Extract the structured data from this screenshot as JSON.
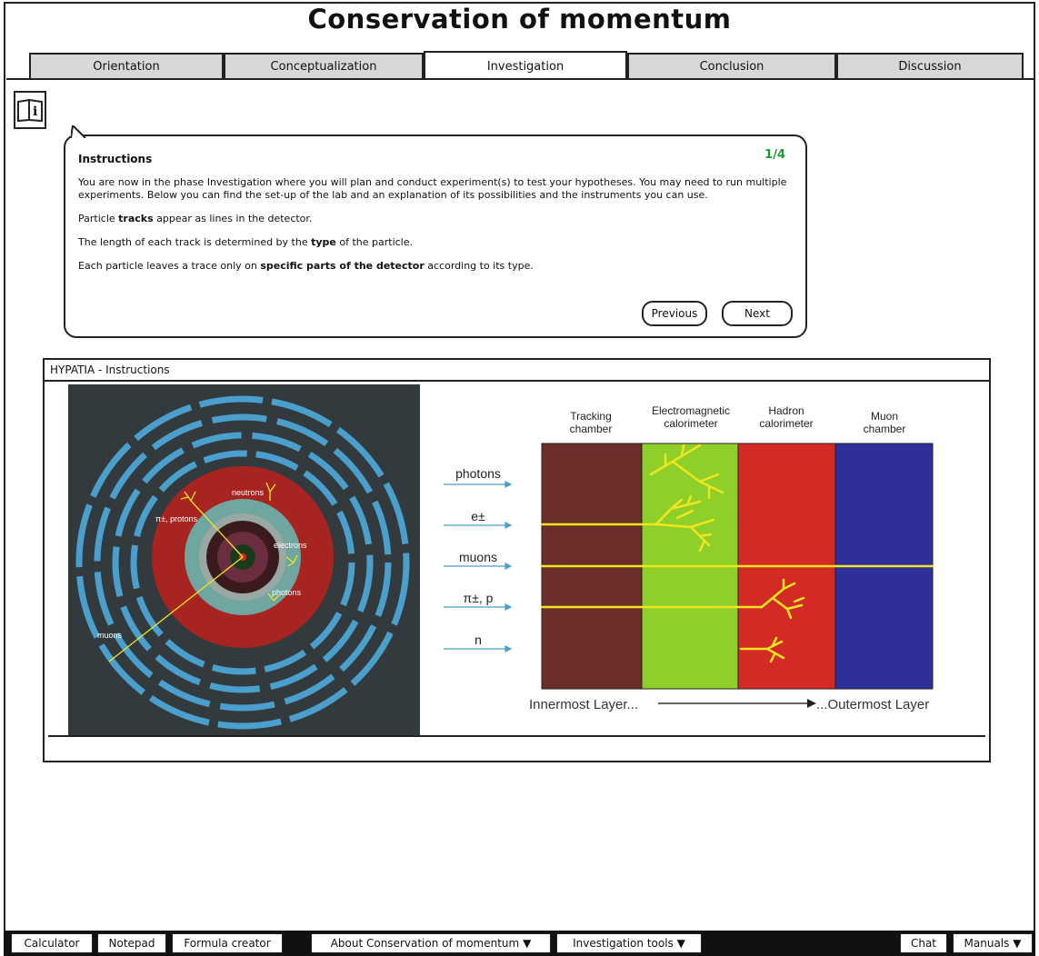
{
  "app": {
    "title": "Conservation of momentum"
  },
  "tabs": [
    {
      "label": "Orientation"
    },
    {
      "label": "Conceptualization"
    },
    {
      "label": "Investigation",
      "active": true
    },
    {
      "label": "Conclusion"
    },
    {
      "label": "Discussion"
    }
  ],
  "instructions": {
    "title": "Instructions",
    "page": "1/4",
    "paragraph1": "You are now in the phase Investigation where you will plan and conduct experiment(s) to test your hypotheses. You may need to run multiple experiments. Below you can find the set-up of the lab and an explanation of its possibilities and the instruments you can use.",
    "p2_pre": "Particle ",
    "p2_bold": "tracks",
    "p2_post": " appear as lines in the detector.",
    "p3_pre": "The length of each track is determined by the ",
    "p3_bold": "type",
    "p3_post": " of the particle.",
    "p4_pre": "Each particle leaves a trace only on ",
    "p4_bold": "specific parts of the detector",
    "p4_post": " according to its type.",
    "previous_label": "Previous",
    "next_label": "Next"
  },
  "panel": {
    "title": "HYPATIA - Instructions",
    "detector_labels": {
      "neutrons": "neutrons",
      "pions_protons": "π±, protons",
      "electrons": "electrons",
      "photons": "photons",
      "muons": "muons"
    },
    "particles": [
      "photons",
      "e±",
      "muons",
      "π±, p",
      "n"
    ],
    "layers": [
      {
        "line1": "Tracking",
        "line2": "chamber",
        "color": "#6b2e2a"
      },
      {
        "line1": "Electromagnetic",
        "line2": "calorimeter",
        "color": "#8fcf2a"
      },
      {
        "line1": "Hadron",
        "line2": "calorimeter",
        "color": "#d42a26"
      },
      {
        "line1": "Muon",
        "line2": "chamber",
        "color": "#2e2f9a"
      }
    ],
    "inner_label": "Innermost Layer...",
    "outer_label": "...Outermost Layer"
  },
  "bottom_bar": {
    "calculator": "Calculator",
    "notepad": "Notepad",
    "formula_creator": "Formula creator",
    "about": "About Conservation of momentum",
    "investigation_tools": "Investigation tools",
    "chat": "Chat",
    "manuals": "Manuals"
  },
  "colors": {
    "track": "#f0e61e",
    "accent_green": "#1a9a2a",
    "ring_blue": "#4a9fcc"
  }
}
